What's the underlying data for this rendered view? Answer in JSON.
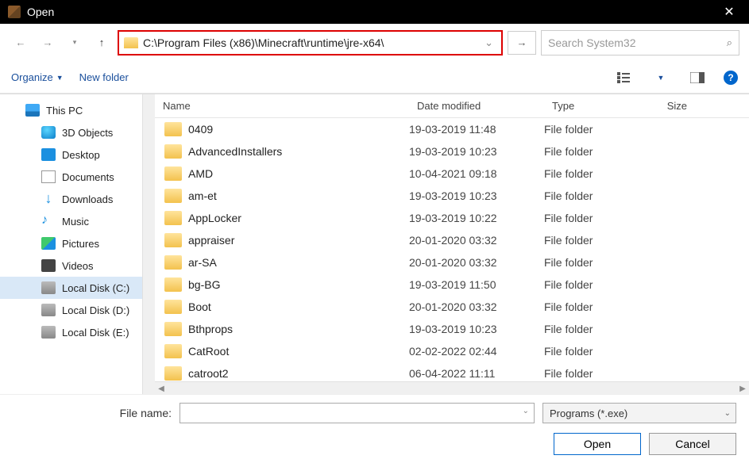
{
  "window": {
    "title": "Open"
  },
  "nav": {
    "path": "C:\\Program Files (x86)\\Minecraft\\runtime\\jre-x64\\",
    "search_placeholder": "Search System32"
  },
  "toolbar": {
    "organize": "Organize",
    "new_folder": "New folder"
  },
  "sidebar": {
    "items": [
      {
        "label": "This PC",
        "icon": "pc",
        "child": false,
        "selected": false
      },
      {
        "label": "3D Objects",
        "icon": "3d",
        "child": true,
        "selected": false
      },
      {
        "label": "Desktop",
        "icon": "desktop",
        "child": true,
        "selected": false
      },
      {
        "label": "Documents",
        "icon": "doc",
        "child": true,
        "selected": false
      },
      {
        "label": "Downloads",
        "icon": "down",
        "child": true,
        "selected": false
      },
      {
        "label": "Music",
        "icon": "music",
        "child": true,
        "selected": false
      },
      {
        "label": "Pictures",
        "icon": "pic",
        "child": true,
        "selected": false
      },
      {
        "label": "Videos",
        "icon": "vid",
        "child": true,
        "selected": false
      },
      {
        "label": "Local Disk (C:)",
        "icon": "disk",
        "child": true,
        "selected": true
      },
      {
        "label": "Local Disk (D:)",
        "icon": "disk",
        "child": true,
        "selected": false
      },
      {
        "label": "Local Disk (E:)",
        "icon": "disk",
        "child": true,
        "selected": false
      }
    ]
  },
  "columns": {
    "name": "Name",
    "date": "Date modified",
    "type": "Type",
    "size": "Size"
  },
  "files": [
    {
      "name": "0409",
      "date": "19-03-2019 11:48",
      "type": "File folder"
    },
    {
      "name": "AdvancedInstallers",
      "date": "19-03-2019 10:23",
      "type": "File folder"
    },
    {
      "name": "AMD",
      "date": "10-04-2021 09:18",
      "type": "File folder"
    },
    {
      "name": "am-et",
      "date": "19-03-2019 10:23",
      "type": "File folder"
    },
    {
      "name": "AppLocker",
      "date": "19-03-2019 10:22",
      "type": "File folder"
    },
    {
      "name": "appraiser",
      "date": "20-01-2020 03:32",
      "type": "File folder"
    },
    {
      "name": "ar-SA",
      "date": "20-01-2020 03:32",
      "type": "File folder"
    },
    {
      "name": "bg-BG",
      "date": "19-03-2019 11:50",
      "type": "File folder"
    },
    {
      "name": "Boot",
      "date": "20-01-2020 03:32",
      "type": "File folder"
    },
    {
      "name": "Bthprops",
      "date": "19-03-2019 10:23",
      "type": "File folder"
    },
    {
      "name": "CatRoot",
      "date": "02-02-2022 02:44",
      "type": "File folder"
    },
    {
      "name": "catroot2",
      "date": "06-04-2022 11:11",
      "type": "File folder"
    }
  ],
  "footer": {
    "file_name_label": "File name:",
    "file_name_value": "",
    "filter": "Programs (*.exe)",
    "open": "Open",
    "cancel": "Cancel"
  }
}
